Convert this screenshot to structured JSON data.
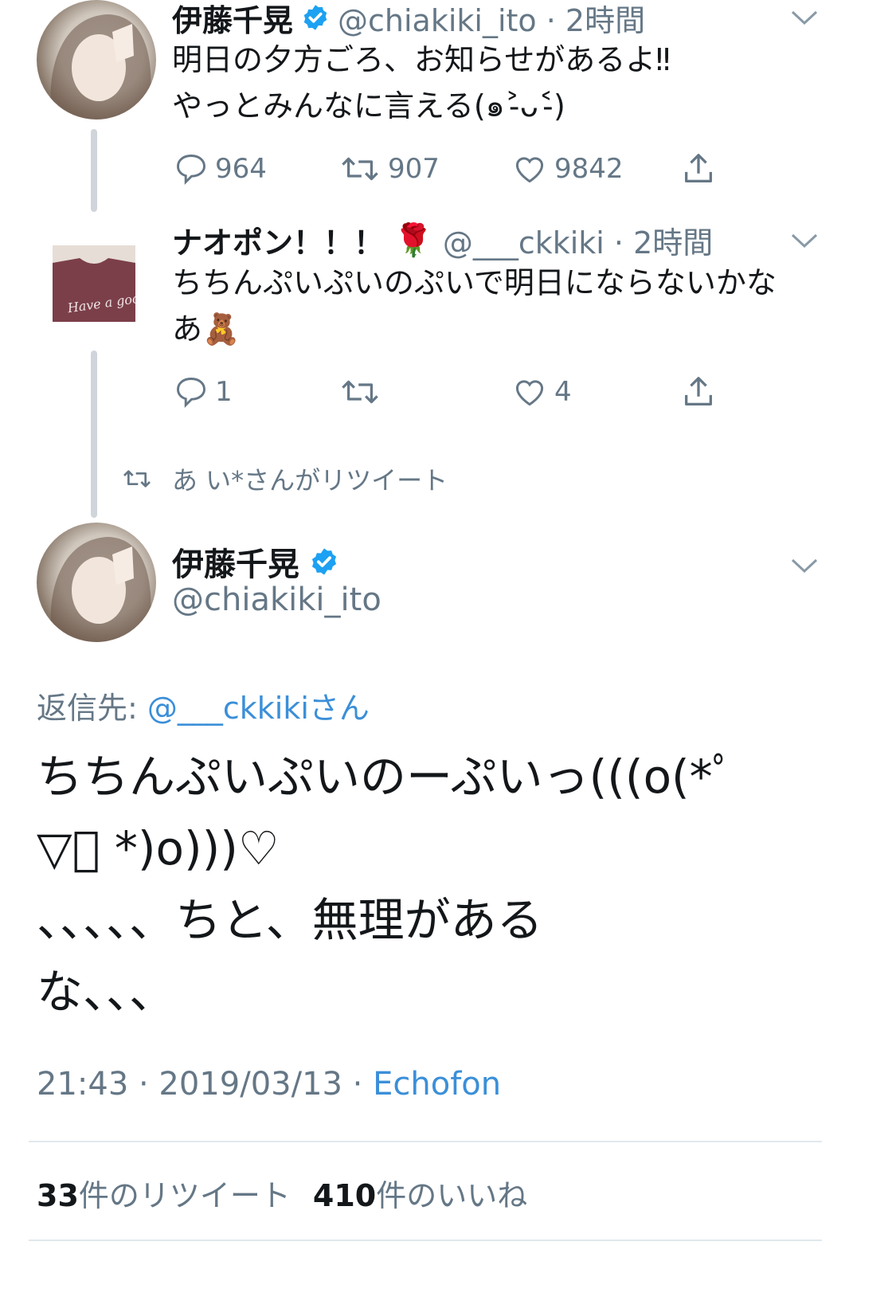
{
  "tweet1": {
    "name": "伊藤千晃",
    "handle_time": "@chiakiki_ito · 2時間",
    "text_line1": "明日の夕方ごろ、お知らせがあるよ‼︎",
    "text_line2": "やっとみんなに言える(๑˃̵ᴗ˂̵)",
    "replies": "964",
    "retweets": "907",
    "likes": "9842"
  },
  "tweet2": {
    "name": "ナオポン！！！",
    "emoji": "🌹",
    "handle_time": "@___ckkiki · 2時間",
    "text_line1": "ちちんぷいぷいのぷいで明日にならないかな",
    "text_line2": "あ🧸",
    "replies": "1",
    "retweets": "",
    "likes": "4",
    "avatar_text": "Have a good one!!"
  },
  "retweet_notice": "あ い*さんがリツイート",
  "main": {
    "name": "伊藤千晃",
    "handle": "@chiakiki_ito",
    "reply_to_label": "返信先: ",
    "reply_to_user": "@___ckkikiさん",
    "text_line1": "ちちんぷいぷいのーぷいっ(((o(*ﾟ",
    "text_line2": "▽ﾟ *)o)))♡",
    "text_line3": "、、、、、ちと、無理がある",
    "text_line4": "な、、、",
    "time_date": "21:43 · 2019/03/13 · ",
    "client": "Echofon",
    "retweet_count": "33",
    "retweet_label": "件のリツイート",
    "like_count": "410",
    "like_label": "件のいいね"
  },
  "colors": {
    "accent": "#1da1f2",
    "link": "#3b8fd8",
    "muted": "#657786",
    "thread_line": "#cfd5da",
    "divider": "#e1e8ed"
  },
  "icons": [
    "reply-icon",
    "retweet-icon",
    "like-icon",
    "share-icon",
    "chevron-down-icon",
    "verified-badge-icon"
  ]
}
